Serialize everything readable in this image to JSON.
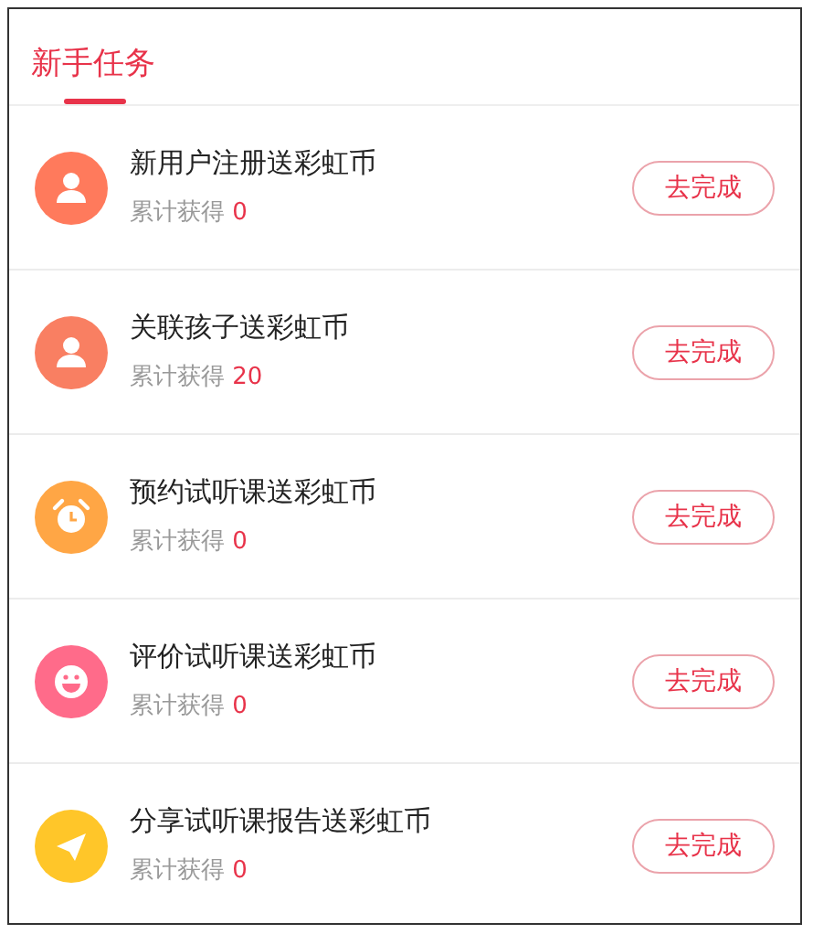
{
  "tabs": [
    {
      "label": "新手任务",
      "selected": true
    }
  ],
  "tasks": [
    {
      "kind": "user",
      "color": "#ff7a5c",
      "title": "新用户注册送彩虹币",
      "earned_label": "累计获得",
      "earned": "0",
      "button": "去完成"
    },
    {
      "kind": "user",
      "color": "#f97f62",
      "title": "关联孩子送彩虹币",
      "earned_label": "累计获得",
      "earned": "20",
      "button": "去完成"
    },
    {
      "kind": "alarm",
      "color": "#ffa645",
      "title": "预约试听课送彩虹币",
      "earned_label": "累计获得",
      "earned": "0",
      "button": "去完成"
    },
    {
      "kind": "smile",
      "color": "#ff6b8a",
      "title": "评价试听课送彩虹币",
      "earned_label": "累计获得",
      "earned": "0",
      "button": "去完成"
    },
    {
      "kind": "plane",
      "color": "#ffc629",
      "title": "分享试听课报告送彩虹币",
      "earned_label": "累计获得",
      "earned": "0",
      "button": "去完成"
    }
  ]
}
